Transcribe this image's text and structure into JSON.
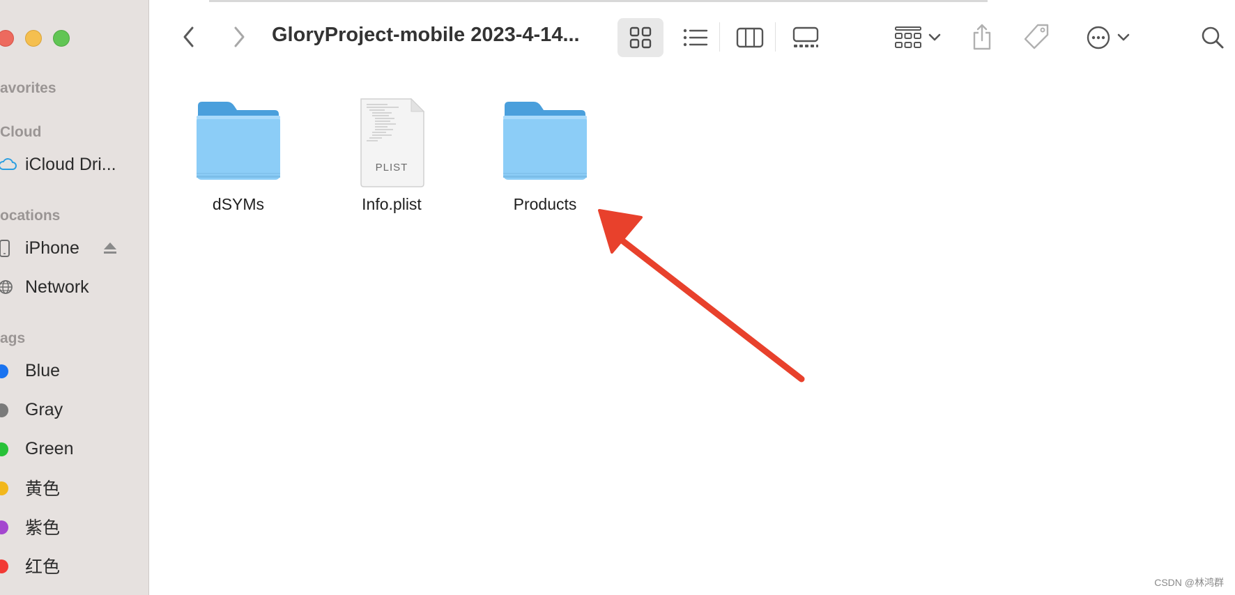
{
  "window": {
    "title": "GloryProject-mobile 2023-4-14..."
  },
  "sidebar": {
    "sections": {
      "favorites": "avorites",
      "icloud": "Cloud",
      "locations": "ocations",
      "tags": "ags"
    },
    "icloud_items": [
      {
        "label": "iCloud Dri...",
        "icon": "cloud-icon"
      }
    ],
    "location_items": [
      {
        "label": "iPhone",
        "icon": "iphone-icon"
      },
      {
        "label": "Network",
        "icon": "globe-icon"
      }
    ],
    "tag_items": [
      {
        "label": "Blue",
        "color": "#1a73f0"
      },
      {
        "label": "Gray",
        "color": "#7a7a7a"
      },
      {
        "label": "Green",
        "color": "#28c138"
      },
      {
        "label": "黄色",
        "color": "#f2b71c"
      },
      {
        "label": "紫色",
        "color": "#a447cf"
      },
      {
        "label": "红色",
        "color": "#f23a35"
      }
    ]
  },
  "files": [
    {
      "name": "dSYMs",
      "type": "folder"
    },
    {
      "name": "Info.plist",
      "type": "plist",
      "badge": "PLIST"
    },
    {
      "name": "Products",
      "type": "folder"
    }
  ],
  "colors": {
    "folder_light": "#8ccdf7",
    "folder_dark": "#4a9fdc",
    "arrow": "#e8412c"
  },
  "watermark": "CSDN @林鸿群"
}
